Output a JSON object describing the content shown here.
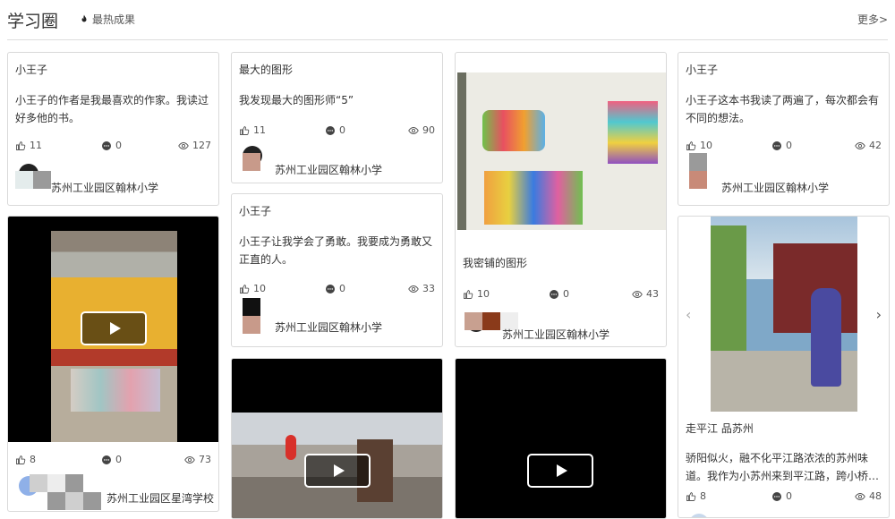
{
  "header": {
    "title": "学习圈",
    "hot_label": "最热成果",
    "more_label": "更多>"
  },
  "cards": [
    {
      "title": "小王子",
      "text": "小王子的作者是我最喜欢的作家。我读过好多他的书。",
      "likes": "11",
      "comments": "0",
      "views": "127",
      "school": "苏州工业园区翰林小学"
    },
    {
      "title": "最大的图形",
      "text": "我发现最大的图形师“5”",
      "likes": "11",
      "comments": "0",
      "views": "90",
      "school": "苏州工业园区翰林小学"
    },
    {
      "title": "",
      "text": "我密铺的图形",
      "likes": "10",
      "comments": "0",
      "views": "43",
      "school": "苏州工业园区翰林小学"
    },
    {
      "title": "小王子",
      "text": "小王子这本书我读了两遍了，每次都会有不同的想法。",
      "likes": "10",
      "comments": "0",
      "views": "42",
      "school": "苏州工业园区翰林小学"
    },
    {
      "title": "",
      "text": "",
      "likes": "8",
      "comments": "0",
      "views": "73",
      "school": "苏州工业园区星湾学校（小学部）"
    },
    {
      "title": "小王子",
      "text": "小王子让我学会了勇敢。我要成为勇敢又正直的人。",
      "likes": "10",
      "comments": "0",
      "views": "33",
      "school": "苏州工业园区翰林小学"
    },
    {
      "title": "走平江 品苏州",
      "text": "骄阳似火，融不化平江路浓浓的苏州味道。我作为小苏州来到平江路，跨小桥…",
      "likes": "8",
      "comments": "0",
      "views": "48",
      "school": ""
    }
  ],
  "colors": {
    "accent": "#333333",
    "border": "#d9d9d9"
  },
  "icons": {
    "like": "thumbs-up-icon",
    "comment": "comment-icon",
    "view": "eye-icon",
    "hot": "fire-icon",
    "play": "play-icon"
  }
}
